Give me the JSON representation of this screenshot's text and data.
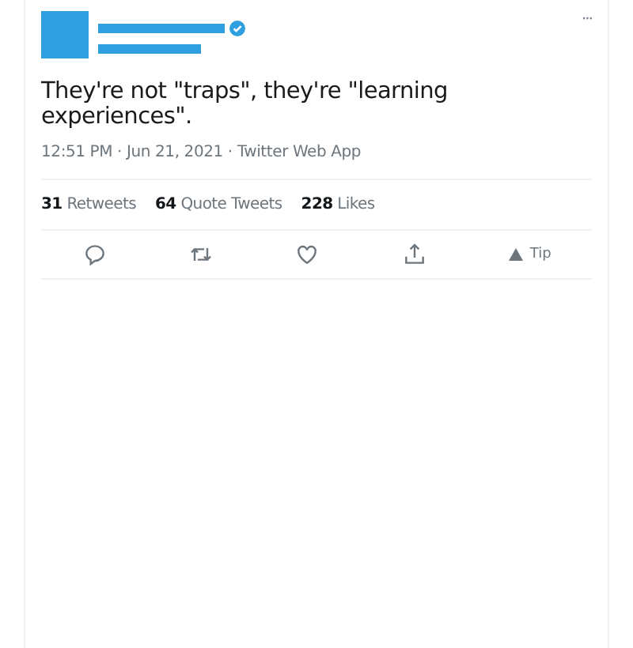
{
  "tweet": {
    "verified": true,
    "text": "They're not \"traps\", they're \"learning experiences\".",
    "meta": "12:51 PM · Jun 21, 2021 · Twitter Web App",
    "more": "···",
    "stats": [
      {
        "count": "31",
        "label": "Retweets"
      },
      {
        "count": "64",
        "label": "Quote Tweets"
      },
      {
        "count": "228",
        "label": "Likes"
      }
    ],
    "actions": [
      {
        "kind": "reply"
      },
      {
        "kind": "retweet"
      },
      {
        "kind": "like"
      },
      {
        "kind": "share"
      },
      {
        "kind": "tip",
        "label": "Tip"
      }
    ]
  }
}
